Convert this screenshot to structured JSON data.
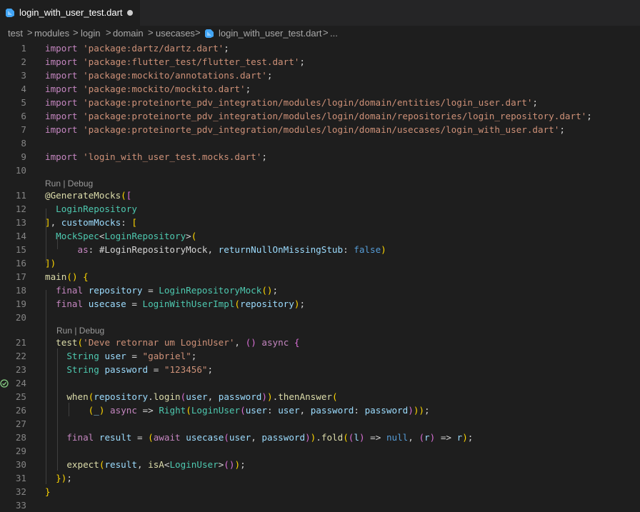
{
  "tab": {
    "filename": "login_with_user_test.dart",
    "icon": "dart-file-icon",
    "modified": true
  },
  "breadcrumb": {
    "items": [
      "test",
      "modules",
      "login",
      "domain",
      "usecases",
      "login_with_user_test.dart"
    ],
    "separator": ">",
    "overflow": "..."
  },
  "codelens": {
    "run_debug": "Run | Debug"
  },
  "editor": {
    "line_numbers": [
      "1",
      "2",
      "3",
      "4",
      "5",
      "6",
      "7",
      "8",
      "9",
      "10",
      "11",
      "12",
      "13",
      "14",
      "15",
      "16",
      "17",
      "18",
      "19",
      "20",
      "21",
      "22",
      "23",
      "24",
      "25",
      "26",
      "27",
      "28",
      "29",
      "30",
      "31",
      "32",
      "33"
    ],
    "lines": [
      "import 'package:dartz/dartz.dart';",
      "import 'package:flutter_test/flutter_test.dart';",
      "import 'package:mockito/annotations.dart';",
      "import 'package:mockito/mockito.dart';",
      "import 'package:proteinorte_pdv_integration/modules/login/domain/entities/login_user.dart';",
      "import 'package:proteinorte_pdv_integration/modules/login/domain/repositories/login_repository.dart';",
      "import 'package:proteinorte_pdv_integration/modules/login/domain/usecases/login_with_user.dart';",
      "",
      "import 'login_with_user_test.mocks.dart';",
      "",
      "@GenerateMocks([",
      "  LoginRepository",
      "], customMocks: [",
      "  MockSpec<LoginRepository>(",
      "      as: #LoginRepositoryMock, returnNullOnMissingStub: false)",
      "])",
      "main() {",
      "  final repository = LoginRepositoryMock();",
      "  final usecase = LoginWithUserImpl(repository);",
      "",
      "  test('Deve retornar um LoginUser', () async {",
      "    String user = \"gabriel\";",
      "    String password = \"123456\";",
      "",
      "    when(repository.login(user, password)).thenAnswer(",
      "        (_) async => Right(LoginUser(user: user, password: password)));",
      "",
      "    final result = (await usecase(user, password)).fold((l) => null, (r) => r);",
      "",
      "    expect(result, isA<LoginUser>());",
      "  });",
      "}",
      ""
    ]
  },
  "colors": {
    "background": "#1e1e1e",
    "tabbar": "#252526",
    "keyword": "#c586c0",
    "string": "#ce9178",
    "type": "#4ec9b0",
    "function": "#dcdcaa",
    "variable": "#9cdcfe",
    "line_number": "#858585",
    "test_pass": "#89d185"
  }
}
